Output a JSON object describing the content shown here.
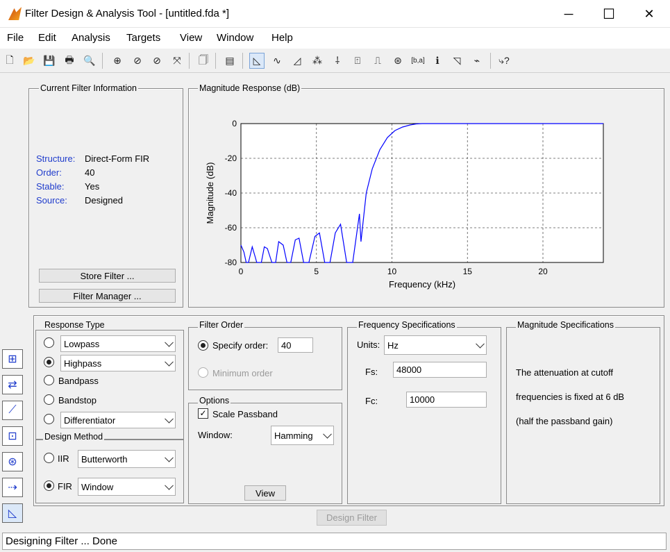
{
  "window": {
    "title": "Filter Design & Analysis Tool -  [untitled.fda *]",
    "minimize": "─",
    "maximize": "☐",
    "close": "✕"
  },
  "menu": [
    "File",
    "Edit",
    "Analysis",
    "Targets",
    "View",
    "Window",
    "Help"
  ],
  "toolbar": {
    "icons": [
      "new-icon",
      "open-icon",
      "save-icon",
      "print-icon",
      "print-preview-icon",
      "zoom-in-icon",
      "zoom-x-icon",
      "zoom-y-icon",
      "full-view-icon",
      "new-figure-icon",
      "filter-specs-icon",
      "magnitude-icon",
      "phase-icon",
      "mag-phase-icon",
      "group-delay-icon",
      "phase-delay-icon",
      "impulse-icon",
      "step-icon",
      "pole-zero-icon",
      "coefficients-icon",
      "info-icon",
      "magnitude-estimate-icon",
      "noise-power-icon",
      "whats-this-icon"
    ],
    "glyphs": [
      "🗋",
      "📂",
      "💾",
      "🖶",
      "🔍",
      "⊕",
      "⊘",
      "⊘",
      "⤧",
      "🗍",
      "▤",
      "◺",
      "∿",
      "◿",
      "⁂",
      "⸸",
      "⍐",
      "⎍",
      "⊛",
      "[b,a]",
      "ℹ",
      "◹",
      "⌁",
      "⤷?"
    ]
  },
  "current_filter": {
    "legend": "Current Filter Information",
    "rows": [
      {
        "label": "Structure:",
        "value": "Direct-Form FIR"
      },
      {
        "label": "Order:",
        "value": "40"
      },
      {
        "label": "Stable:",
        "value": "Yes"
      },
      {
        "label": "Source:",
        "value": "Designed"
      }
    ],
    "store_button": "Store Filter ...",
    "manager_button": "Filter Manager ..."
  },
  "magnitude_panel": {
    "legend": "Magnitude Response (dB)"
  },
  "chart_data": {
    "type": "line",
    "xlabel": "Frequency (kHz)",
    "ylabel": "Magnitude (dB)",
    "xlim": [
      0,
      24
    ],
    "ylim": [
      -80,
      0
    ],
    "xticks": [
      0,
      5,
      10,
      15,
      20
    ],
    "yticks": [
      0,
      -20,
      -40,
      -60,
      -80
    ],
    "grid": true,
    "color": "#0000ff",
    "series": [
      {
        "x": [
          0,
          0.2,
          0.35,
          0.5,
          0.75,
          0.95,
          1.05,
          1.35,
          1.55,
          1.75,
          2.05,
          2.3,
          2.5,
          2.8,
          3.05,
          3.3,
          3.6,
          3.85,
          4.15,
          4.5,
          4.9,
          5.2,
          5.55,
          5.9,
          6.25,
          6.6,
          7.0,
          7.4,
          7.85,
          7.95,
          8.3,
          8.7,
          9.2,
          9.7,
          10.2,
          10.7,
          11.2,
          11.6,
          12.0,
          13,
          16,
          20,
          24
        ],
        "y": [
          -70,
          -74,
          -80,
          -80,
          -71,
          -77,
          -80,
          -80,
          -71,
          -72,
          -80,
          -80,
          -68,
          -70,
          -80,
          -80,
          -67,
          -66,
          -80,
          -80,
          -65,
          -63,
          -80,
          -80,
          -63,
          -58,
          -80,
          -80,
          -52,
          -68,
          -40,
          -26,
          -15,
          -8,
          -4,
          -2,
          -0.8,
          -0.2,
          0,
          0,
          0,
          0,
          0
        ]
      }
    ]
  },
  "response_type": {
    "legend": "Response Type",
    "lowpass": "Lowpass",
    "highpass": "Highpass",
    "bandpass": "Bandpass",
    "bandstop": "Bandstop",
    "differentiator": "Differentiator",
    "selected": "Highpass"
  },
  "design_method": {
    "legend": "Design Method",
    "iir_label": "IIR",
    "iir_type": "Butterworth",
    "fir_label": "FIR",
    "fir_type": "Window",
    "selected": "FIR"
  },
  "filter_order": {
    "legend": "Filter Order",
    "specify_label": "Specify order:",
    "specify_value": "40",
    "minimum_label": "Minimum order"
  },
  "options": {
    "legend": "Options",
    "scale_passband": "Scale Passband",
    "scale_checked": true,
    "window_label": "Window:",
    "window_value": "Hamming",
    "view_button": "View"
  },
  "freq_specs": {
    "legend": "Frequency Specifications",
    "units_label": "Units:",
    "units_value": "Hz",
    "fs_label": "Fs:",
    "fs_value": "48000",
    "fc_label": "Fc:",
    "fc_value": "10000"
  },
  "mag_specs": {
    "legend": "Magnitude Specifications",
    "line1": "The attenuation at cutoff",
    "line2": "frequencies is fixed at 6 dB",
    "line3": "(half the passband gain)"
  },
  "design_button": "Design Filter",
  "sidebar": [
    "sidebar-xform-icon",
    "sidebar-import-icon",
    "sidebar-design-icon",
    "sidebar-quantize-icon",
    "sidebar-pole-zero-icon",
    "sidebar-realize-icon",
    "sidebar-multirate-icon"
  ],
  "status": "Designing Filter ... Done"
}
